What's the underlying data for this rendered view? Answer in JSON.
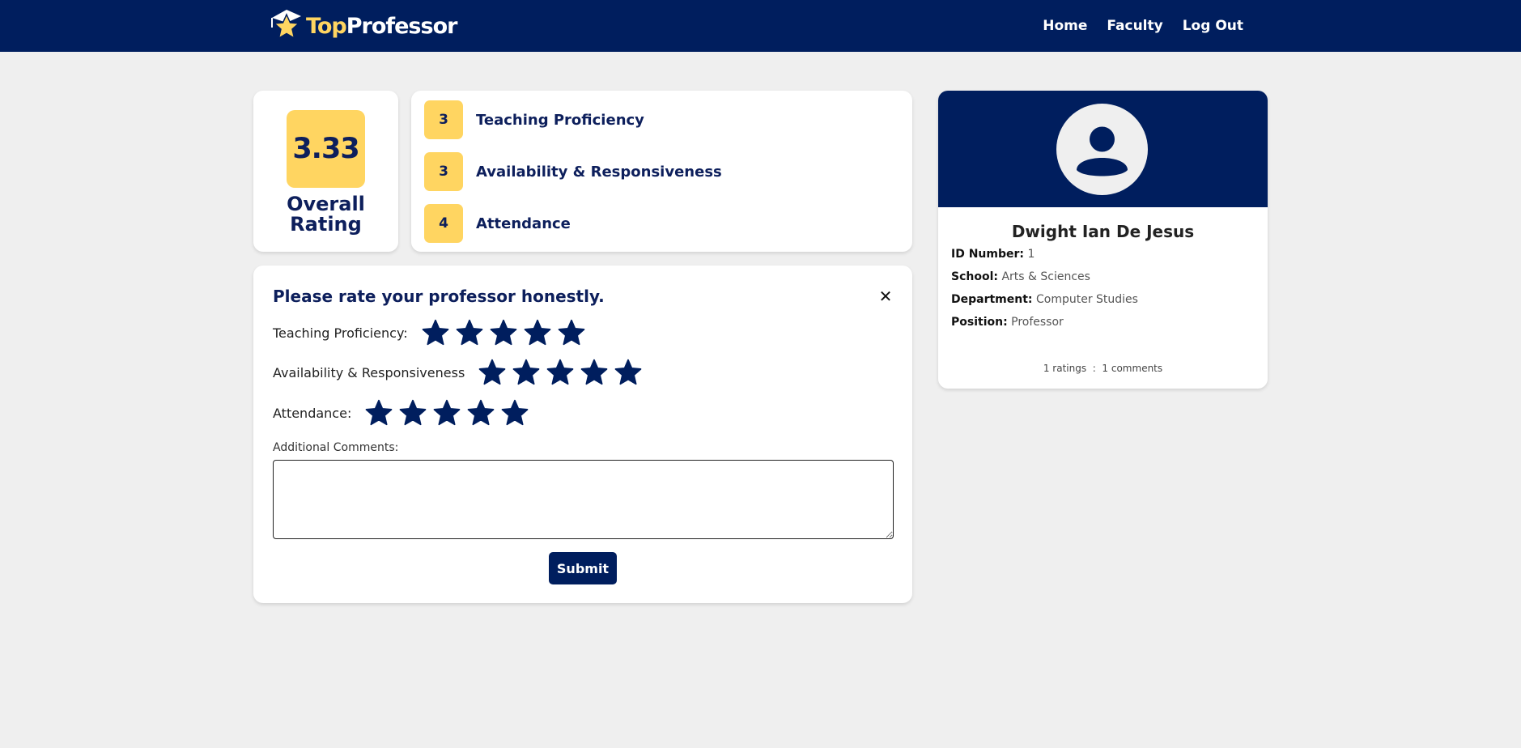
{
  "brand": {
    "name_part1": "Top",
    "name_part2": "Professor",
    "icon": "star-graduation-cap-icon"
  },
  "nav": {
    "links": [
      "Home",
      "Faculty",
      "Log Out"
    ]
  },
  "overall": {
    "value": "3.33",
    "label": "Overall Rating"
  },
  "scores": [
    {
      "value": "3",
      "label": "Teaching Proficiency"
    },
    {
      "value": "3",
      "label": "Availability & Responsiveness"
    },
    {
      "value": "4",
      "label": "Attendance"
    }
  ],
  "rating_form": {
    "title": "Please rate your professor honestly.",
    "close_icon": "close-icon",
    "criteria": [
      {
        "label": "Teaching Proficiency:",
        "stars": 5
      },
      {
        "label": "Availability & Responsiveness",
        "stars": 5
      },
      {
        "label": "Attendance:",
        "stars": 5
      }
    ],
    "comments_label": "Additional Comments:",
    "comments_value": "",
    "submit_label": "Submit"
  },
  "profile": {
    "name": "Dwight Ian De Jesus",
    "fields": [
      {
        "key": "ID Number:",
        "value": "1"
      },
      {
        "key": "School:",
        "value": "Arts & Sciences"
      },
      {
        "key": "Department:",
        "value": "Computer Studies"
      },
      {
        "key": "Position:",
        "value": "Professor"
      }
    ],
    "ratings_count": "1 ratings",
    "separator": ":",
    "comments_count": "1 comments"
  },
  "colors": {
    "navy": "#001e5e",
    "gold": "#ffd561",
    "background": "#efefef",
    "text_navy": "#0d1f5c"
  }
}
